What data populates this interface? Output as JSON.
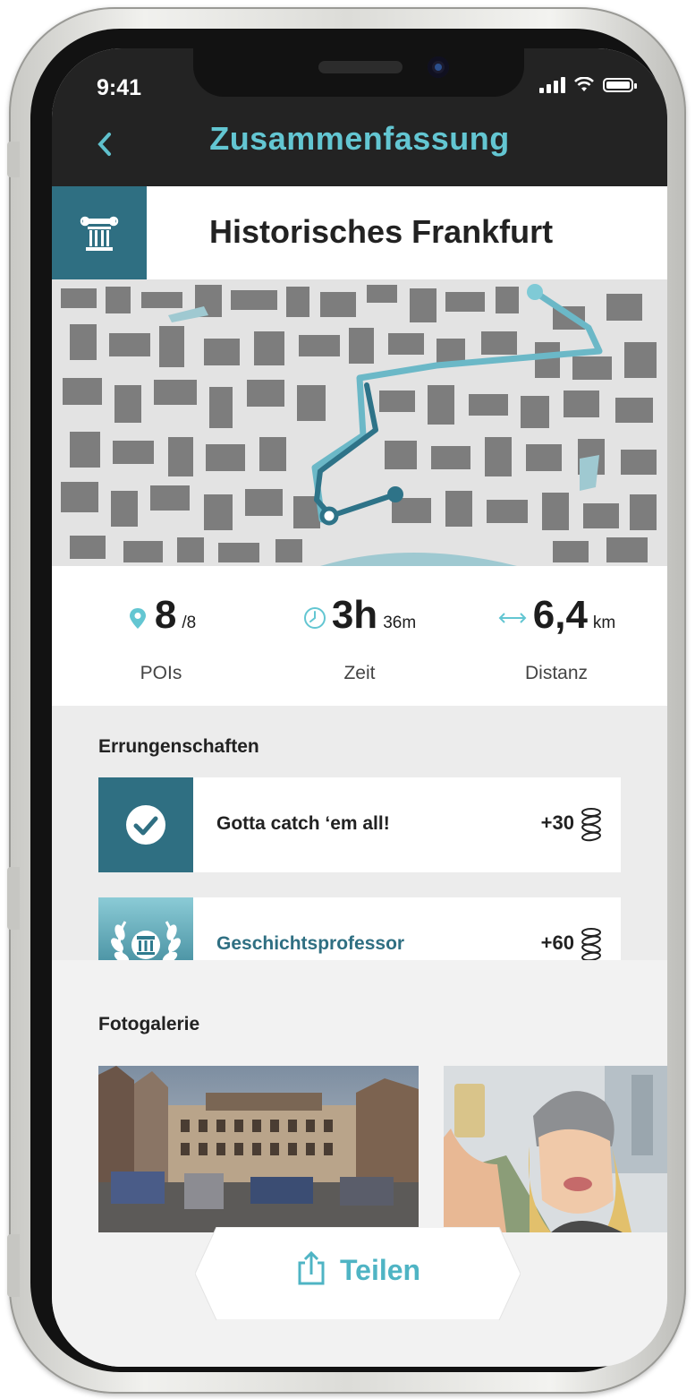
{
  "status_bar": {
    "time": "9:41"
  },
  "nav": {
    "title": "Zusammenfassung",
    "back_icon": "chevron-left-icon"
  },
  "tour": {
    "title": "Historisches Frankfurt",
    "icon": "temple-column-icon"
  },
  "stats": [
    {
      "value": "8",
      "suffix": "/8",
      "label": "POIs",
      "icon": "map-pin-icon"
    },
    {
      "value": "3h",
      "suffix": "36m",
      "label": "Zeit",
      "icon": "clock-icon"
    },
    {
      "value": "6,4",
      "suffix": "km",
      "label": "Distanz",
      "icon": "arrow-both-ways-icon"
    }
  ],
  "achievements": {
    "title": "Errungenschaften",
    "items": [
      {
        "name": "Gotta catch ‘em all!",
        "points": "+30",
        "icon": "checkmark-circle-icon",
        "name_color": "#222222"
      },
      {
        "name": "Geschichtsprofessor",
        "points": "+60",
        "icon": "laurel-column-icon",
        "name_color": "#2f6f82"
      }
    ]
  },
  "gallery": {
    "title": "Fotogalerie"
  },
  "share": {
    "label": "Teilen",
    "icon": "share-icon"
  },
  "colors": {
    "accent": "#63c6d2",
    "dark_teal": "#2f6f82",
    "route": "#4fa6b6"
  }
}
